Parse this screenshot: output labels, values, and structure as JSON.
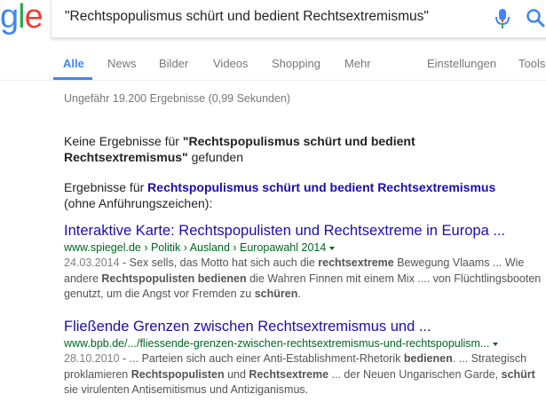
{
  "logo": {
    "text_g": "g",
    "text_l": "l",
    "text_e": "e"
  },
  "search": {
    "query": "\"Rechtspopulismus schürt und bedient Rechtsextremismus\""
  },
  "tabs": [
    "Alle",
    "News",
    "Bilder",
    "Videos",
    "Shopping",
    "Mehr",
    "Einstellungen",
    "Tools"
  ],
  "stats": "Ungefähr 19.200 Ergebnisse (0,99 Sekunden)",
  "no_results": {
    "prefix": "Keine Ergebnisse für ",
    "query": "\"Rechtspopulismus schürt und bedient Rechtsextremismus\"",
    "suffix": " gefunden"
  },
  "alt_results": {
    "prefix": "Ergebnisse für ",
    "query": "Rechtspopulismus schürt und bedient Rechtsextremismus",
    "suffix": "(ohne Anführungszeichen):"
  },
  "results": [
    {
      "title": "Interaktive Karte: Rechtspopulisten und Rechtsextreme in Europa ...",
      "url": "www.spiegel.de › Politik › Ausland › Europawahl 2014",
      "date": "24.03.2014",
      "snippet_parts": [
        {
          "t": " - Sex sells, das Motto hat sich auch die ",
          "b": false
        },
        {
          "t": "rechtsextreme",
          "b": true
        },
        {
          "t": " Bewegung Vlaams ... Wie andere ",
          "b": false
        },
        {
          "t": "Rechtspopulisten bedienen",
          "b": true
        },
        {
          "t": " die Wahren Finnen mit einem Mix .... von Flüchtlingsbooten genutzt, um die Angst vor Fremden zu ",
          "b": false
        },
        {
          "t": "schüren",
          "b": true
        },
        {
          "t": ".",
          "b": false
        }
      ]
    },
    {
      "title": "Fließende Grenzen zwischen Rechtsextremismus und ...",
      "url": "www.bpb.de/.../fliessende-grenzen-zwischen-rechtsextremismus-und-rechtspopulism...",
      "date": "28.10.2010",
      "snippet_parts": [
        {
          "t": " - ... Parteien sich auch einer Anti-Establishment-Rhetorik ",
          "b": false
        },
        {
          "t": "bedienen",
          "b": true
        },
        {
          "t": ". ... Strategisch proklamieren ",
          "b": false
        },
        {
          "t": "Rechtspopulisten",
          "b": true
        },
        {
          "t": " und ",
          "b": false
        },
        {
          "t": "Rechtsextreme",
          "b": true
        },
        {
          "t": " ... der Neuen Ungarischen Garde, ",
          "b": false
        },
        {
          "t": "schürt",
          "b": true
        },
        {
          "t": " sie virulenten Antisemitismus und Antiziganismus.",
          "b": false
        }
      ]
    }
  ],
  "colors": {
    "link": "#1a0dab",
    "url": "#006621",
    "tab_active": "#4285f4"
  },
  "icons": {
    "mic": "microphone-icon",
    "search": "search-icon"
  }
}
